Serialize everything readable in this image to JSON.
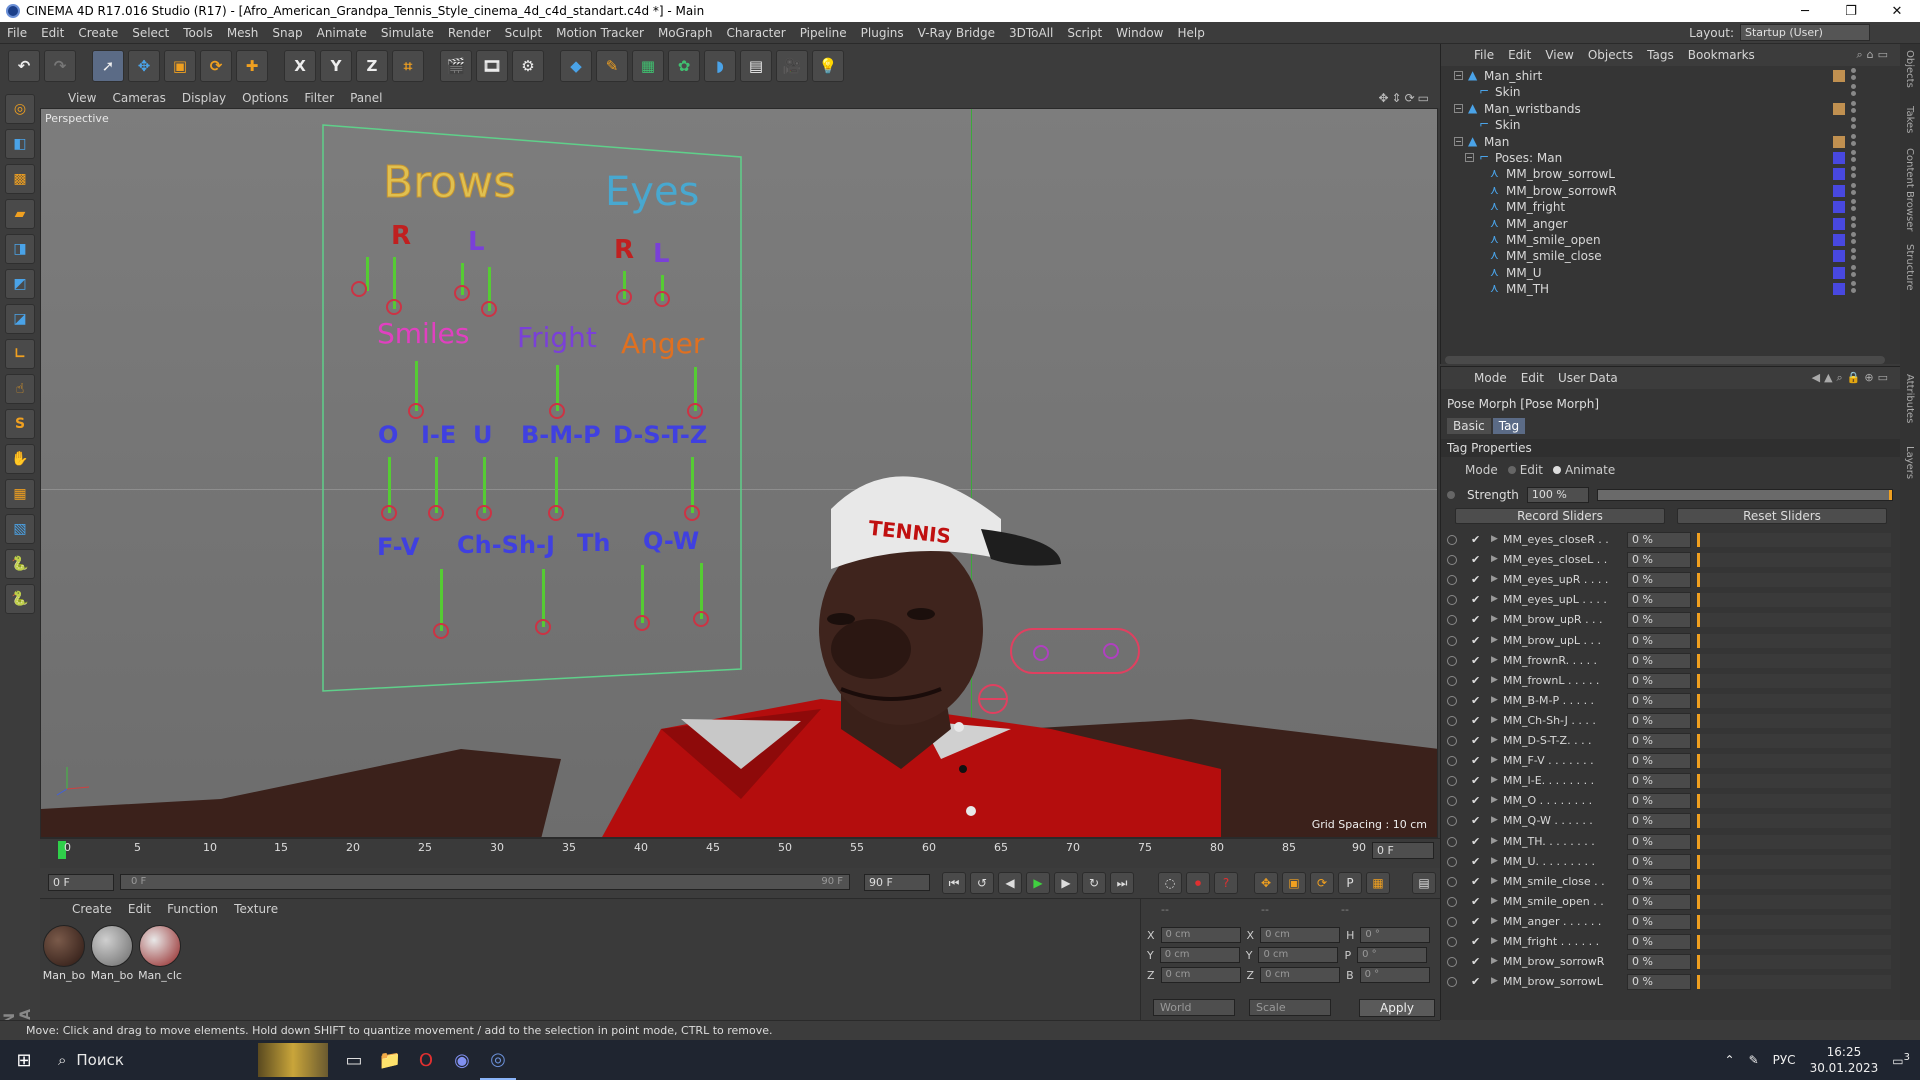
{
  "window": {
    "title": "CINEMA 4D R17.016 Studio (R17) - [Afro_American_Grandpa_Tennis_Style_cinema_4d_c4d_standart.c4d *] - Main",
    "buttons": [
      "─",
      "❐",
      "✕"
    ]
  },
  "menu": [
    "File",
    "Edit",
    "Create",
    "Select",
    "Tools",
    "Mesh",
    "Snap",
    "Animate",
    "Simulate",
    "Render",
    "Sculpt",
    "Motion Tracker",
    "MoGraph",
    "Character",
    "Pipeline",
    "Plugins",
    "V-Ray Bridge",
    "3DToAll",
    "Script",
    "Window",
    "Help"
  ],
  "layout": {
    "label": "Layout:",
    "value": "Startup (User)"
  },
  "viewport": {
    "menu": [
      "View",
      "Cameras",
      "Display",
      "Options",
      "Filter",
      "Panel"
    ],
    "camera_label": "Perspective",
    "grid_spacing": "Grid Spacing : 10 cm",
    "panel_labels": {
      "brows": "Brows",
      "eyes": "Eyes",
      "brow_r": "R",
      "brow_l": "L",
      "eye_r": "R",
      "eye_l": "L",
      "smiles": "Smiles",
      "fright": "Fright",
      "anger": "Anger",
      "o": "O",
      "ie": "I-E",
      "u": "U",
      "bmp": "B-M-P",
      "dstz": "D-S-T-Z",
      "fv": "F-V",
      "chshj": "Ch-Sh-J",
      "th": "Th",
      "qw": "Q-W"
    },
    "cap_text": "TENNIS"
  },
  "timeline": {
    "ticks": [
      "0",
      "5",
      "10",
      "15",
      "20",
      "25",
      "30",
      "35",
      "40",
      "45",
      "50",
      "55",
      "60",
      "65",
      "70",
      "75",
      "80",
      "85",
      "90"
    ],
    "current_frame": "0 F"
  },
  "transport": {
    "start": "0 F",
    "range_start": "0 F",
    "range_end": "90 F",
    "end": "90 F"
  },
  "materials": {
    "menu": [
      "Create",
      "Edit",
      "Function",
      "Texture"
    ],
    "items": [
      {
        "name": "Man_bo",
        "color": "#3a2a24"
      },
      {
        "name": "Man_bo",
        "color": "#8a8a8a"
      },
      {
        "name": "Man_clc",
        "color": "#b04040"
      }
    ]
  },
  "coords": {
    "headers": [
      "--",
      "--",
      "--"
    ],
    "rows": [
      {
        "a": "X",
        "av": "0 cm",
        "b": "X",
        "bv": "0 cm",
        "c": "H",
        "cv": "0 °"
      },
      {
        "a": "Y",
        "av": "0 cm",
        "b": "Y",
        "bv": "0 cm",
        "c": "P",
        "cv": "0 °"
      },
      {
        "a": "Z",
        "av": "0 cm",
        "b": "Z",
        "bv": "0 cm",
        "c": "B",
        "cv": "0 °"
      }
    ],
    "world": "World",
    "scale": "Scale",
    "apply": "Apply"
  },
  "status": "Move: Click and drag to move elements. Hold down SHIFT to quantize movement / add to the selection in point mode, CTRL to remove.",
  "object_manager": {
    "menu": [
      "File",
      "Edit",
      "View",
      "Objects",
      "Tags",
      "Bookmarks"
    ],
    "rows": [
      {
        "name": "Man_shirt",
        "depth": 1,
        "tree": "−"
      },
      {
        "name": "Skin",
        "depth": 2,
        "tree": ""
      },
      {
        "name": "Man_wristbands",
        "depth": 1,
        "tree": "−"
      },
      {
        "name": "Skin",
        "depth": 2,
        "tree": ""
      },
      {
        "name": "Man",
        "depth": 1,
        "tree": "−"
      },
      {
        "name": "Poses: Man",
        "depth": 2,
        "tree": "−"
      },
      {
        "name": "MM_brow_sorrowL",
        "depth": 3,
        "tree": ""
      },
      {
        "name": "MM_brow_sorrowR",
        "depth": 3,
        "tree": ""
      },
      {
        "name": "MM_fright",
        "depth": 3,
        "tree": ""
      },
      {
        "name": "MM_anger",
        "depth": 3,
        "tree": ""
      },
      {
        "name": "MM_smile_open",
        "depth": 3,
        "tree": ""
      },
      {
        "name": "MM_smile_close",
        "depth": 3,
        "tree": ""
      },
      {
        "name": "MM_U",
        "depth": 3,
        "tree": ""
      },
      {
        "name": "MM_TH",
        "depth": 3,
        "tree": ""
      }
    ]
  },
  "attributes": {
    "menu": [
      "Mode",
      "Edit",
      "User Data"
    ],
    "title": "Pose Morph [Pose Morph]",
    "tabs": [
      "Basic",
      "Tag"
    ],
    "section": "Tag Properties",
    "mode_label": "Mode",
    "mode_edit": "Edit",
    "mode_animate": "Animate",
    "strength_label": "Strength",
    "strength_value": "100 %",
    "strength_fraction": 1.0,
    "record": "Record Sliders",
    "reset": "Reset Sliders",
    "morphs": [
      {
        "name": "MM_eyes_closeR . .",
        "value": "0 %"
      },
      {
        "name": "MM_eyes_closeL . .",
        "value": "0 %"
      },
      {
        "name": "MM_eyes_upR . . . .",
        "value": "0 %"
      },
      {
        "name": "MM_eyes_upL . . . .",
        "value": "0 %"
      },
      {
        "name": "MM_brow_upR . . .",
        "value": "0 %"
      },
      {
        "name": "MM_brow_upL . . .",
        "value": "0 %"
      },
      {
        "name": "MM_frownR. . . . .",
        "value": "0 %"
      },
      {
        "name": "MM_frownL . . . . .",
        "value": "0 %"
      },
      {
        "name": "MM_B-M-P . . . . .",
        "value": "0 %"
      },
      {
        "name": "MM_Ch-Sh-J . . . .",
        "value": "0 %"
      },
      {
        "name": "MM_D-S-T-Z. . . .",
        "value": "0 %"
      },
      {
        "name": "MM_F-V . . . . . . .",
        "value": "0 %"
      },
      {
        "name": "MM_I-E. . . . . . . .",
        "value": "0 %"
      },
      {
        "name": "MM_O . . . . . . . .",
        "value": "0 %"
      },
      {
        "name": "MM_Q-W . . . . . .",
        "value": "0 %"
      },
      {
        "name": "MM_TH. . . . . . . .",
        "value": "0 %"
      },
      {
        "name": "MM_U. . . . . . . . .",
        "value": "0 %"
      },
      {
        "name": "MM_smile_close . .",
        "value": "0 %"
      },
      {
        "name": "MM_smile_open . .",
        "value": "0 %"
      },
      {
        "name": "MM_anger . . . . . .",
        "value": "0 %"
      },
      {
        "name": "MM_fright . . . . . .",
        "value": "0 %"
      },
      {
        "name": "MM_brow_sorrowR",
        "value": "0 %"
      },
      {
        "name": "MM_brow_sorrowL",
        "value": "0 %"
      }
    ]
  },
  "right_strip": [
    "Objects",
    "Takes",
    "Content Browser",
    "Structure",
    "Attributes",
    "Layers"
  ],
  "taskbar": {
    "search": "Поиск",
    "lang": "РУС",
    "time": "16:25",
    "date": "30.01.2023",
    "notif": "3"
  },
  "colors": {
    "accent": "#f0a020",
    "selection": "#5b6b86",
    "slider_green": "#55cc33",
    "knob_red": "#cc3344"
  }
}
